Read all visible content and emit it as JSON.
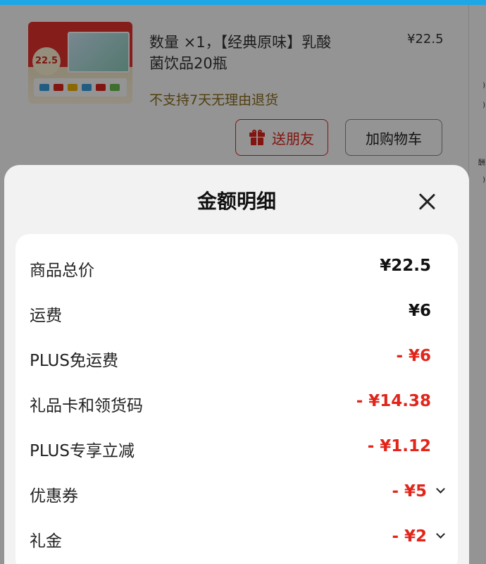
{
  "product": {
    "thumb_badge": "22.5",
    "title": "数量 ×1，【经典原味】乳酸菌饮品20瓶",
    "price": "¥22.5",
    "notice": "不支持7天无理由退货",
    "gift_button": "送朋友",
    "cart_button": "加购物车"
  },
  "sheet": {
    "title": "金额明细",
    "rows": [
      {
        "label": "商品总价",
        "value": "¥22.5"
      },
      {
        "label": "运费",
        "value": "¥6"
      },
      {
        "label": "PLUS免运费",
        "value": "- ¥6"
      },
      {
        "label": "礼品卡和领货码",
        "value": "- ¥14.38"
      },
      {
        "label": "PLUS专享立减",
        "value": "- ¥1.12"
      },
      {
        "label": "优惠券",
        "value": "- ¥5"
      },
      {
        "label": "礼金",
        "value": "- ¥2"
      }
    ]
  },
  "side_fragments": [
    ")",
    ")",
    "酬",
    ")"
  ],
  "colors": {
    "accent_red": "#e1251b",
    "top_bar": "#1da7e6",
    "notice_text": "#8a6d1d"
  },
  "icons": [
    "gift-icon",
    "close-icon",
    "chevron-down-icon"
  ]
}
